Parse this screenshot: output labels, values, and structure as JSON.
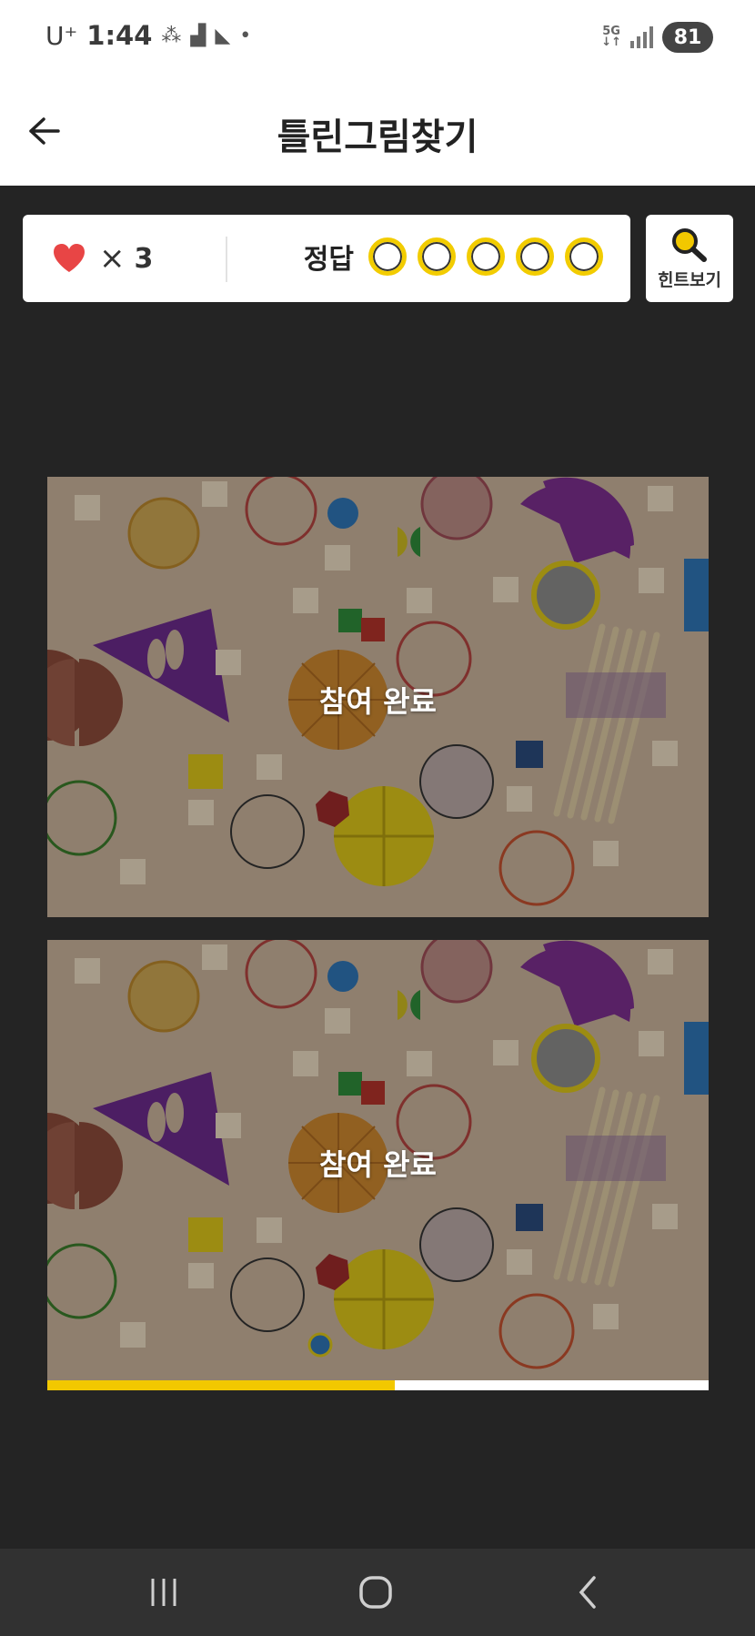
{
  "status_bar": {
    "carrier": "U⁺",
    "time": "1:44",
    "network": "5G",
    "battery": "81"
  },
  "header": {
    "title": "틀린그림찾기"
  },
  "score": {
    "lives_symbol": "×",
    "lives": "3",
    "answers_label": "정답",
    "answers_total": 5,
    "answers_found": 0
  },
  "hint": {
    "label": "힌트보기"
  },
  "images": {
    "top_overlay": "참여 완료",
    "bottom_overlay": "참여 완료"
  },
  "progress": {
    "fraction": 0.525
  },
  "colors": {
    "accent": "#f2c800",
    "heart": "#e84545",
    "background": "#242424"
  }
}
